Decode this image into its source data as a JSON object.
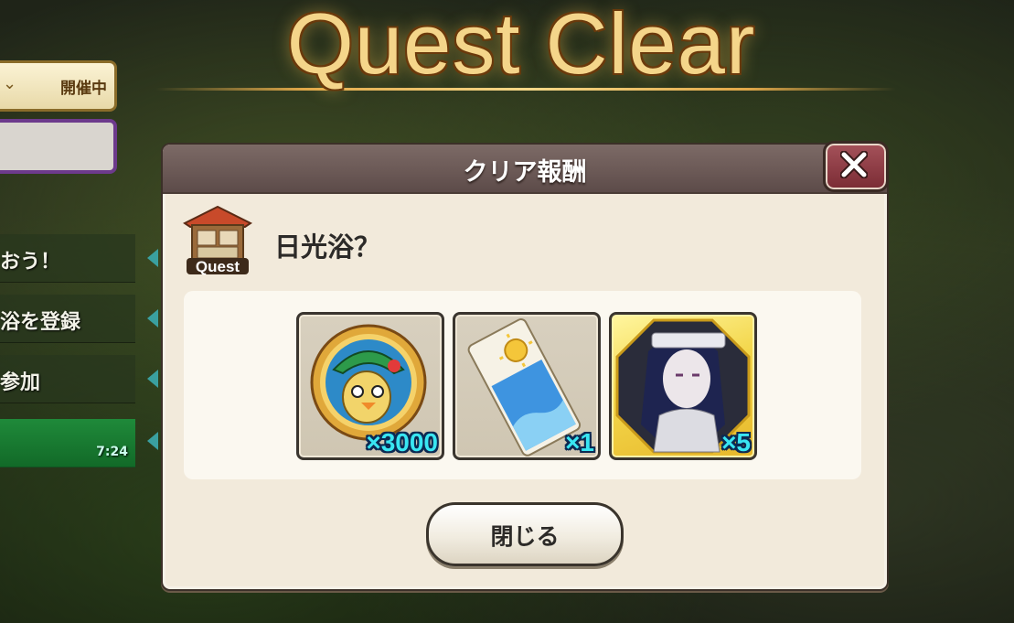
{
  "screen_title": "Quest Clear",
  "background_menu": {
    "top_item": {
      "icon": "chevron-down-icon",
      "label": "開催中"
    },
    "rows": [
      {
        "label": "おう！"
      },
      {
        "label": "浴を登録"
      },
      {
        "label": "参加"
      },
      {
        "label": "",
        "time": "7:24"
      }
    ]
  },
  "dialog": {
    "title": "クリア報酬",
    "close_icon": "close-icon",
    "quest": {
      "icon_label": "Quest",
      "name": "日光浴？"
    },
    "rewards": [
      {
        "icon": "medal-coin-icon",
        "quantity": "×3000"
      },
      {
        "icon": "sun-ticket-icon",
        "quantity": "×1"
      },
      {
        "icon": "character-portrait-icon",
        "quantity": "×5"
      }
    ],
    "close_button_label": "閉じる"
  },
  "colors": {
    "title_gold": "#f4d58a",
    "header_bg": "#6a5855",
    "dialog_bg": "#f2eadb",
    "quantity_cyan": "#39e6f2",
    "close_x_bg": "#7a2b34",
    "active_row_green": "#1f8a3a"
  }
}
